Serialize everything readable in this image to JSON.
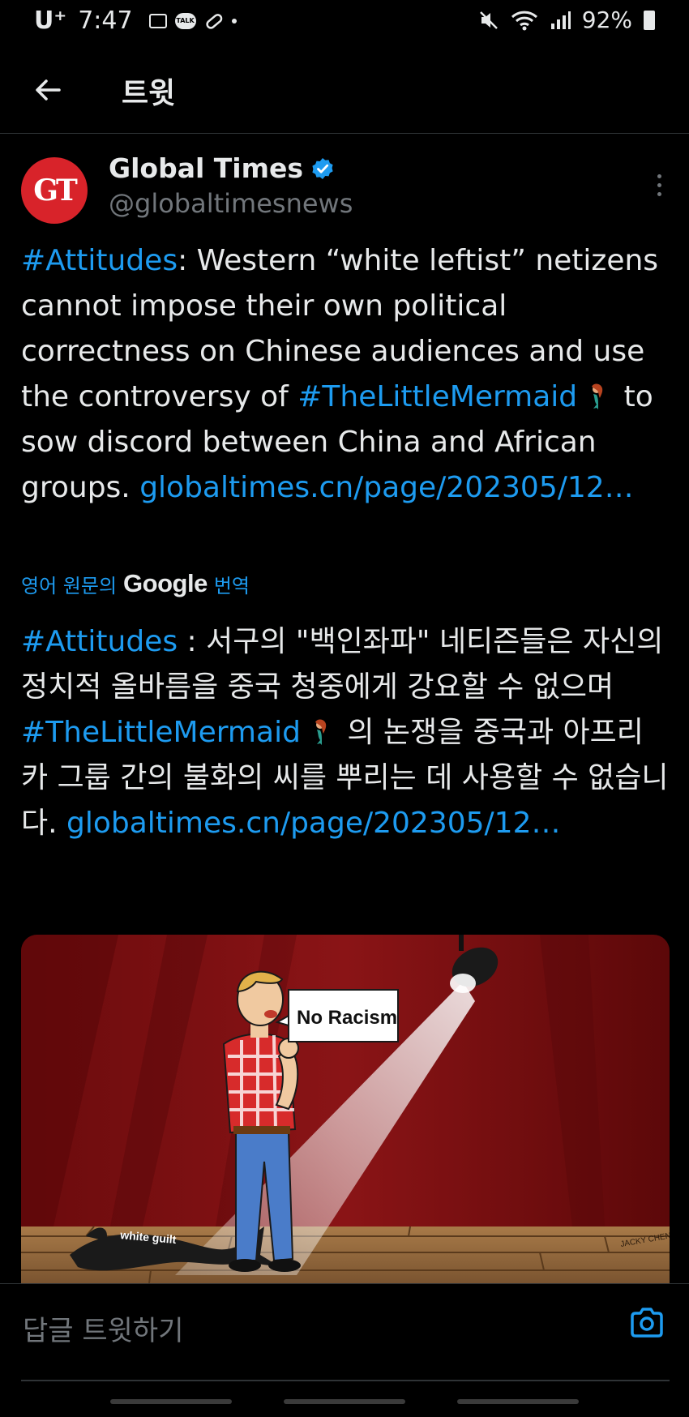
{
  "status_bar": {
    "carrier": "U⁺",
    "time": "7:47",
    "talk_label": "TALK",
    "battery": "92%",
    "icons": [
      "image-icon",
      "kakaotalk-icon",
      "pill-icon",
      "dot-icon",
      "mute-icon",
      "wifi-icon",
      "signal-icon",
      "battery-icon"
    ]
  },
  "header": {
    "title": "트윗",
    "back_icon": "arrow-left-icon"
  },
  "author": {
    "avatar_text": "GT",
    "name": "Global Times",
    "handle": "@globaltimesnews",
    "avatar_color": "#d8232a",
    "verified_color": "#1d9bf0"
  },
  "tweet": {
    "hashtag1": "#Attitudes",
    "text1": ": Western “white leftist” netizens cannot impose their own political correctness on Chinese audiences and use the controversy of ",
    "hashtag2": "#TheLittleMermaid",
    "text2": " to sow discord between China and African groups. ",
    "link": "globaltimes.cn/page/202305/12…"
  },
  "translation": {
    "prefix": "영어 원문의",
    "google": "Google",
    "suffix": "번역",
    "hashtag1": "#Attitudes",
    "text1": " : 서구의 \"백인좌파\" 네티즌들은 자신의 정치적 올바름을 중국 청중에게 강요할 수 없으며 ",
    "hashtag2": "#TheLittleMermaid",
    "text2": " 의 논쟁을 중국과 아프리카 그룹 간의 불화의 씨를 뿌리는 데 사용할 수 없습니다. ",
    "link": "globaltimes.cn/page/202305/12…"
  },
  "media": {
    "speech_bubble": "No Racism",
    "shadow_label": "white guilt",
    "signature": "JACKY\nCHEN",
    "bg_color": "#7a0e10"
  },
  "reply": {
    "placeholder": "답글 트윗하기",
    "camera_icon": "camera-icon"
  }
}
